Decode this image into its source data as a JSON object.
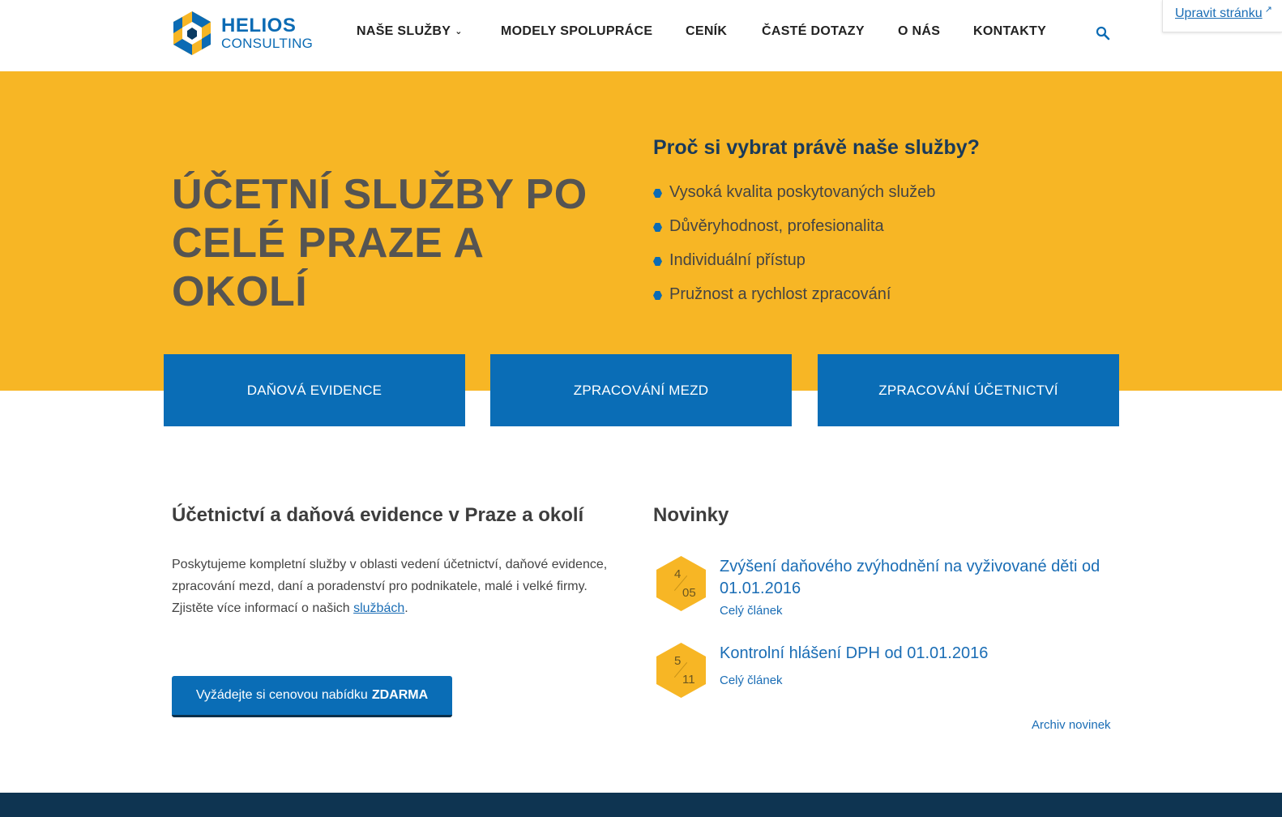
{
  "brand": {
    "name_top": "HELIOS",
    "name_bottom": "CONSULTING",
    "primary": "#0b6bb4",
    "accent": "#f7b625",
    "dark": "#0e3451"
  },
  "nav": {
    "items": [
      "NAŠE SLUŽBY",
      "MODELY SPOLUPRÁCE",
      "CENÍK",
      "ČASTÉ DOTAZY",
      "O NÁS",
      "KONTAKTY"
    ],
    "search_icon": "search-icon"
  },
  "edit_page": {
    "label": "Upravit stránku"
  },
  "hero": {
    "title": "ÚČETNÍ SLUŽBY PO CELÉ PRAZE A OKOLÍ",
    "why_title": "Proč si vybrat právě naše služby?",
    "why_items": [
      "Vysoká kvalita poskytovaných služeb",
      "Důvěryhodnost, profesionalita",
      "Individuální přístup",
      "Pružnost a rychlost zpracování"
    ]
  },
  "services": [
    "DAŇOVÁ EVIDENCE",
    "ZPRACOVÁNÍ MEZD",
    "ZPRACOVÁNÍ ÚČETNICTVÍ"
  ],
  "about": {
    "title": "Účetnictví a daňová evidence v Praze a okolí",
    "text_before": "Poskytujeme kompletní služby v oblasti vedení účetnictví, daňové evidence, zpracování mezd, daní a poradenství pro podnikatele, malé i velké firmy. Zjistěte více informací o našich ",
    "link": "službách",
    "text_after": ".",
    "cta_text": "Vyžádejte si cenovou nabídku",
    "cta_bold": "ZDARMA"
  },
  "news": {
    "title": "Novinky",
    "items": [
      {
        "day": "4",
        "month": "05",
        "title": "Zvýšení daňového zvýhodnění na vyživované děti od 01.01.2016",
        "more": "Celý článek"
      },
      {
        "day": "5",
        "month": "11",
        "title": "Kontrolní hlášení DPH od 01.01.2016",
        "more": "Celý článek"
      }
    ],
    "archive": "Archiv novinek"
  }
}
